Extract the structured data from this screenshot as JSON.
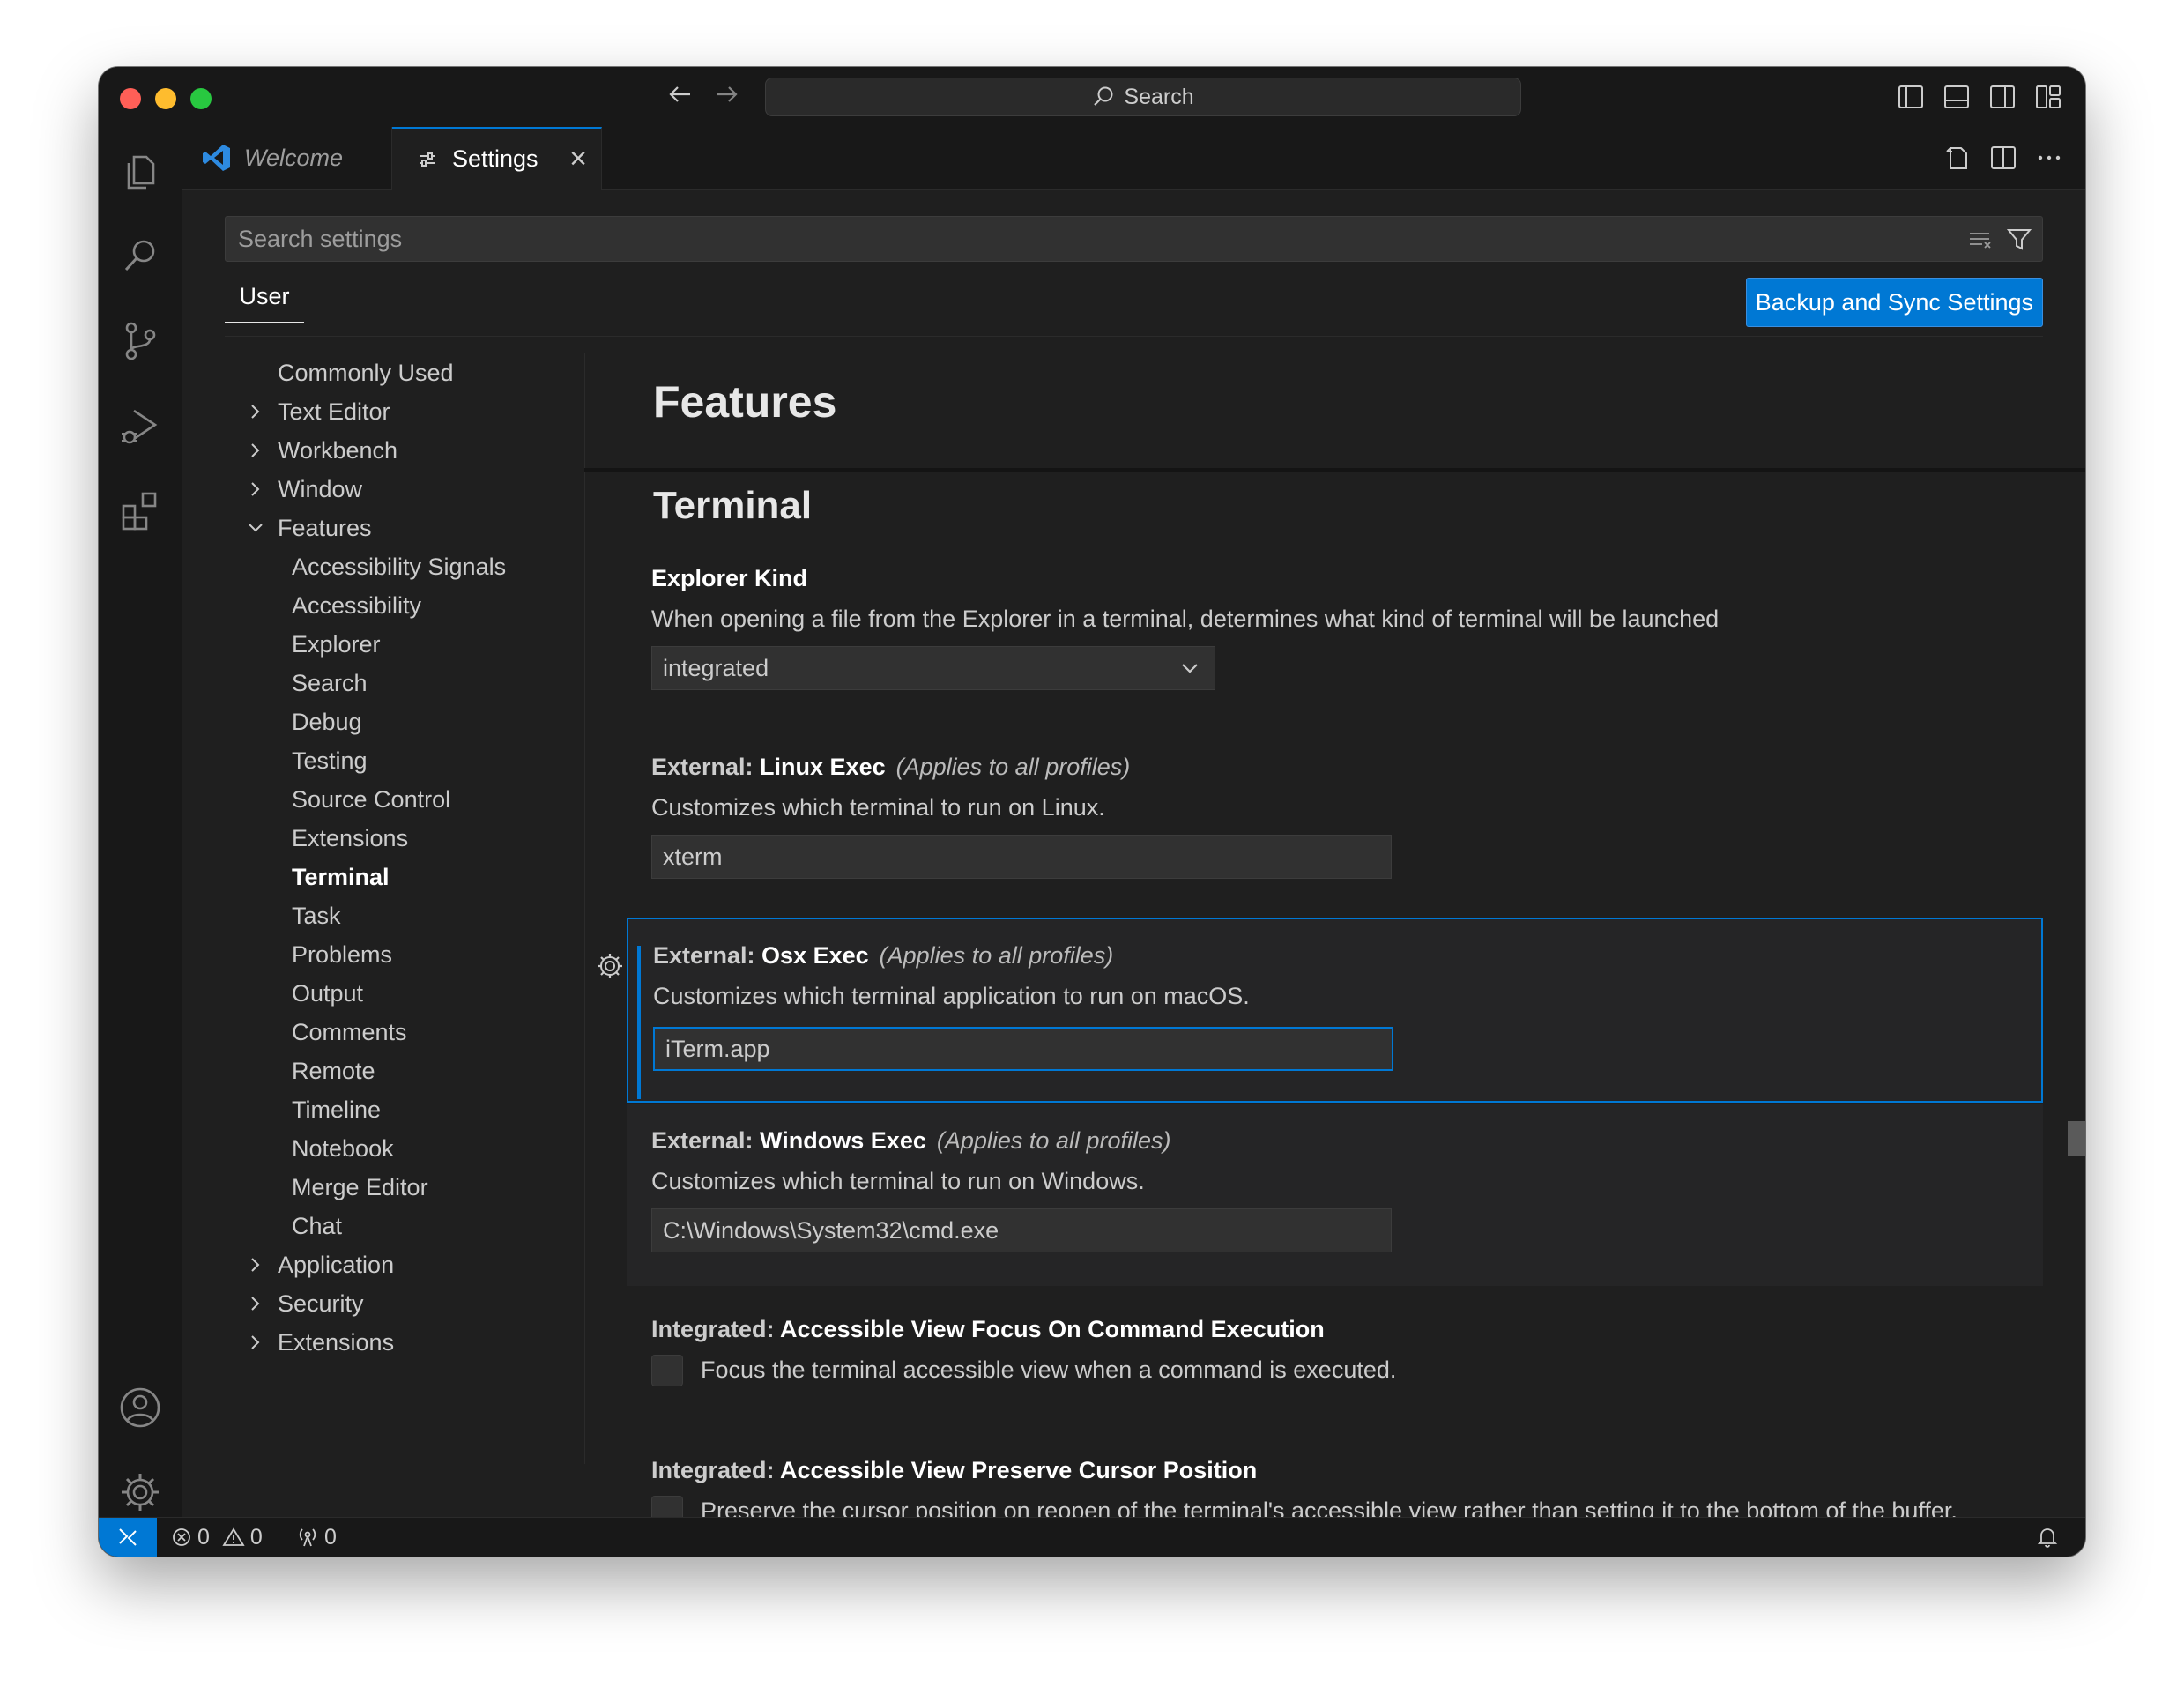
{
  "titlebar": {
    "search_label": "Search",
    "traffic_lights": {
      "close": "#ff5f57",
      "minimize": "#febc2e",
      "maximize": "#28c840"
    }
  },
  "tabs": [
    {
      "label": "Welcome",
      "icon": "vscode-logo-icon"
    },
    {
      "label": "Settings",
      "icon": "settings-sliders-icon",
      "close": "×"
    }
  ],
  "settings": {
    "search_placeholder": "Search settings",
    "scope_tab": "User",
    "backup_button": "Backup and Sync Settings",
    "accent_color": "#0078d4"
  },
  "toc": {
    "commonly_used": "Commonly Used",
    "text_editor": "Text Editor",
    "workbench": "Workbench",
    "window": "Window",
    "features": "Features",
    "features_children": [
      "Accessibility Signals",
      "Accessibility",
      "Explorer",
      "Search",
      "Debug",
      "Testing",
      "Source Control",
      "Extensions",
      "Terminal",
      "Task",
      "Problems",
      "Output",
      "Comments",
      "Remote",
      "Timeline",
      "Notebook",
      "Merge Editor",
      "Chat"
    ],
    "active": "Terminal",
    "application": "Application",
    "security": "Security",
    "extensions": "Extensions"
  },
  "content": {
    "section_title": "Features",
    "subsection_title": "Terminal",
    "explorer_kind": {
      "title": "Explorer Kind",
      "description": "When opening a file from the Explorer in a terminal, determines what kind of terminal will be launched",
      "value": "integrated"
    },
    "linux_exec": {
      "category": "External: ",
      "key": "Linux Exec",
      "note": "(Applies to all profiles)",
      "description": "Customizes which terminal to run on Linux.",
      "value": "xterm"
    },
    "osx_exec": {
      "category": "External: ",
      "key": "Osx Exec",
      "note": "(Applies to all profiles)",
      "description": "Customizes which terminal application to run on macOS.",
      "value": "iTerm.app"
    },
    "windows_exec": {
      "category": "External: ",
      "key": "Windows Exec",
      "note": "(Applies to all profiles)",
      "description": "Customizes which terminal to run on Windows.",
      "value": "C:\\Windows\\System32\\cmd.exe"
    },
    "focus_on_exec": {
      "category": "Integrated: ",
      "key": "Accessible View Focus On Command Execution",
      "description": "Focus the terminal accessible view when a command is executed.",
      "checked": false
    },
    "preserve_cursor": {
      "category": "Integrated: ",
      "key": "Accessible View Preserve Cursor Position",
      "description": "Preserve the cursor position on reopen of the terminal's accessible view rather than setting it to the bottom of the buffer.",
      "checked": false
    }
  },
  "statusbar": {
    "errors": "0",
    "warnings": "0",
    "ports": "0"
  }
}
